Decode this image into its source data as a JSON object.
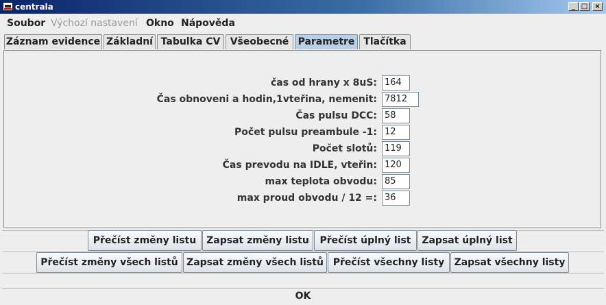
{
  "window": {
    "title": "centrala"
  },
  "menubar": {
    "items": [
      {
        "label": "Soubor",
        "enabled": true
      },
      {
        "label": "Výchozí nastavení",
        "enabled": false
      },
      {
        "label": "Okno",
        "enabled": true
      },
      {
        "label": "Nápověda",
        "enabled": true
      }
    ]
  },
  "tabs": [
    {
      "label": "Záznam evidence"
    },
    {
      "label": "Základní"
    },
    {
      "label": "Tabulka CV"
    },
    {
      "label": "Všeobecné"
    },
    {
      "label": "Parametre",
      "active": true
    },
    {
      "label": "Tlačítka"
    }
  ],
  "params": [
    {
      "label": "čas od hrany x 8uS:",
      "value": "164"
    },
    {
      "label": "Čas obnoveni a hodin,1vteřina, nemenit:",
      "value": "7812"
    },
    {
      "label": "Čas pulsu DCC:",
      "value": "58"
    },
    {
      "label": "Počet pulsu preambule -1:",
      "value": "12"
    },
    {
      "label": "Počet slotů:",
      "value": "119"
    },
    {
      "label": "Čas prevodu na IDLE, vteřin:",
      "value": "120"
    },
    {
      "label": "max teplota obvodu:",
      "value": "85"
    },
    {
      "label": "max proud obvodu / 12 =:",
      "value": "36"
    }
  ],
  "sheet_buttons": [
    {
      "label": "Přečíst změny listu"
    },
    {
      "label": "Zapsat změny listu"
    },
    {
      "label": "Přečíst úplný list"
    },
    {
      "label": "Zapsat úplný list"
    }
  ],
  "all_buttons": [
    {
      "label": "Přečíst změny všech listů"
    },
    {
      "label": "Zapsat změny všech listů"
    },
    {
      "label": "Přečíst všechny listy"
    },
    {
      "label": "Zapsat všechny listy"
    }
  ],
  "ok_label": "OK"
}
